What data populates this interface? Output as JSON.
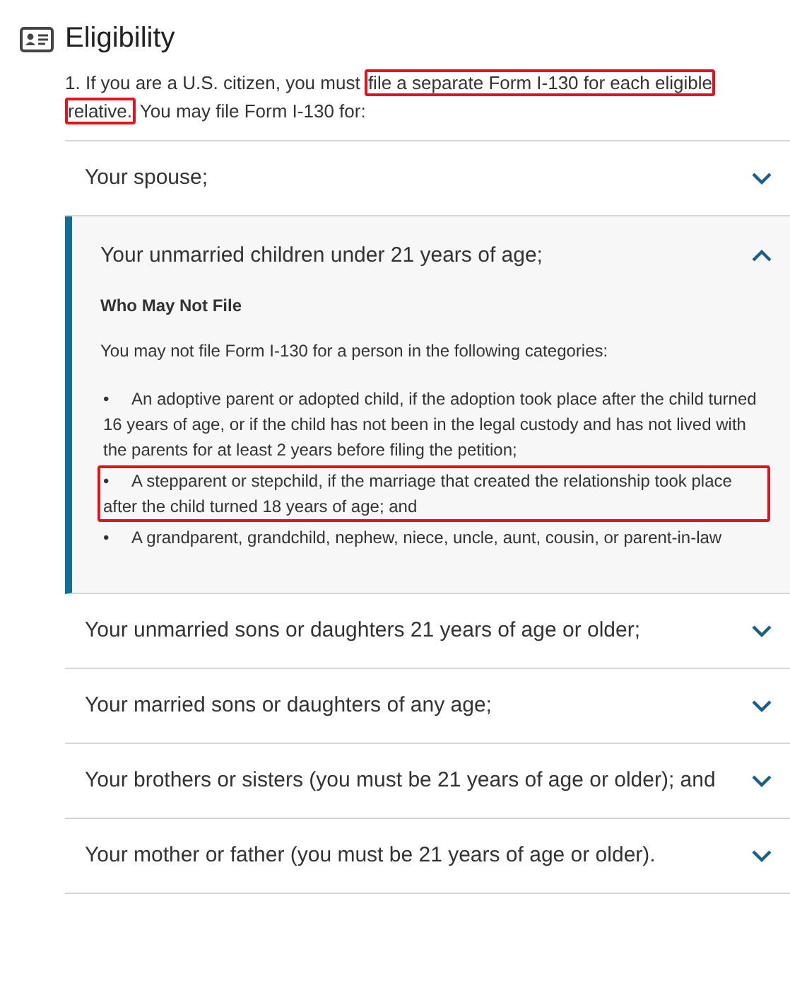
{
  "title": "Eligibility",
  "intro": [
    {
      "text": "1. If you are a U.S. citizen, you must ",
      "highlighted": false
    },
    {
      "text": "file a separate Form I-130 for each eligible relative.",
      "highlighted": true
    },
    {
      "text": " You may file Form I-130 for:",
      "highlighted": false
    }
  ],
  "accordion": [
    {
      "title": "Your spouse;",
      "expanded": false
    },
    {
      "title": "Your unmarried children under 21 years of age;",
      "expanded": true,
      "content": {
        "heading": "Who May Not File",
        "text": "You may not file Form I-130 for a person in the following categories:",
        "items": [
          {
            "bullet": "•",
            "text": "An adoptive parent or adopted child, if the adoption took place after the child turned 16 years of age, or if the child has not been in the legal custody and has not lived with the parents for at least 2 years before filing the petition;",
            "highlighted": false
          },
          {
            "bullet": "•",
            "text": "A stepparent or stepchild, if the marriage that created the relationship took place after the child turned 18 years of age; and",
            "highlighted": true
          },
          {
            "bullet": "•",
            "text": "A grandparent, grandchild, nephew, niece, uncle, aunt, cousin, or parent-in-law",
            "highlighted": false
          }
        ]
      }
    },
    {
      "title": "Your unmarried sons or daughters 21 years of age or older;",
      "expanded": false
    },
    {
      "title": "Your married sons or daughters of any age;",
      "expanded": false
    },
    {
      "title": "Your brothers or sisters (you must be 21 years of age or older); and",
      "expanded": false
    },
    {
      "title": "Your mother or father (you must be 21 years of age or older).",
      "expanded": false
    }
  ]
}
